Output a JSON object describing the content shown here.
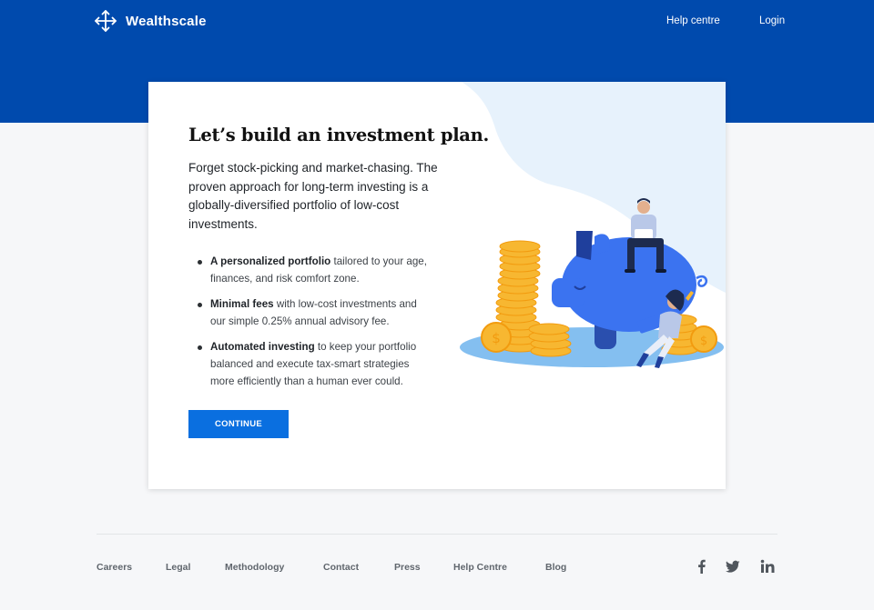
{
  "header": {
    "brand": "Wealthscale",
    "nav": {
      "help": "Help centre",
      "login": "Login"
    },
    "colors": {
      "primary": "#004aad",
      "accent": "#0a6fe0"
    }
  },
  "card": {
    "heading": "Let’s build an investment plan.",
    "intro": "Forget stock-picking and market-chasing. The proven approach for long-term investing is a globally-diversified portfolio of low-cost investments.",
    "bullets": [
      {
        "bold": "A personalized portfolio",
        "text": " tailored to your age, finances, and risk comfort zone."
      },
      {
        "bold": "Minimal fees",
        "text": " with low-cost investments and our simple 0.25% annual advisory fee."
      },
      {
        "bold": "Automated investing",
        "text": " to keep your portfolio balanced and execute tax-smart strategies more efficiently than a human ever could."
      }
    ],
    "button": "CONTINUE"
  },
  "footer": {
    "links": [
      "Careers",
      "Legal",
      "Methodology",
      "Contact",
      "Press",
      "Help Centre",
      "Blog"
    ],
    "social_icons": [
      "facebook-icon",
      "twitter-icon",
      "linkedin-icon"
    ]
  }
}
